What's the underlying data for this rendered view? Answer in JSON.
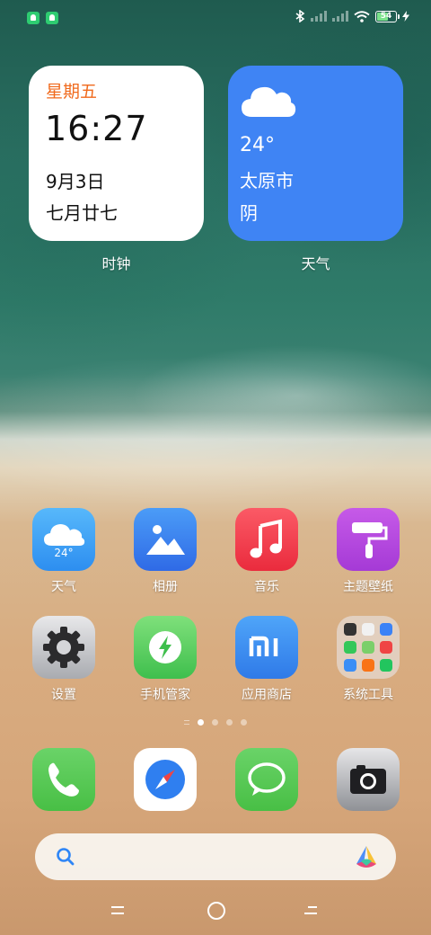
{
  "status_bar": {
    "battery_level": "54",
    "icons": [
      "notification-icon",
      "notification-icon",
      "bluetooth-icon",
      "signal-icon",
      "signal-icon",
      "wifi-icon",
      "battery-icon",
      "charging-icon"
    ]
  },
  "clock_widget": {
    "weekday": "星期五",
    "time": "16:27",
    "date": "9月3日",
    "lunar_date": "七月廿七",
    "label": "时钟"
  },
  "weather_widget": {
    "temperature": "24°",
    "city": "太原市",
    "condition": "阴",
    "label": "天气",
    "icon": "cloud-icon"
  },
  "apps": [
    {
      "label": "天气",
      "icon": "weather-icon",
      "temp": "24°"
    },
    {
      "label": "相册",
      "icon": "gallery-icon"
    },
    {
      "label": "音乐",
      "icon": "music-icon"
    },
    {
      "label": "主题壁纸",
      "icon": "theme-icon"
    },
    {
      "label": "设置",
      "icon": "settings-icon"
    },
    {
      "label": "手机管家",
      "icon": "security-icon"
    },
    {
      "label": "应用商店",
      "icon": "app-store-icon"
    },
    {
      "label": "系统工具",
      "icon": "folder-icon"
    }
  ],
  "page_indicator": {
    "pages": 4,
    "active": 1
  },
  "dock": [
    {
      "icon": "phone-icon"
    },
    {
      "icon": "browser-icon"
    },
    {
      "icon": "messages-icon"
    },
    {
      "icon": "camera-icon"
    }
  ],
  "search_bar": {
    "icon": "search-icon",
    "assistant_icon": "assistant-icon"
  },
  "nav_bar": [
    "menu-icon",
    "home-icon",
    "back-icon"
  ],
  "colors": {
    "weekday_orange": "#f06a1d",
    "weather_blue": "#3f84f4",
    "battery_green": "#7be38b",
    "notification_green": "#2ecc71"
  }
}
